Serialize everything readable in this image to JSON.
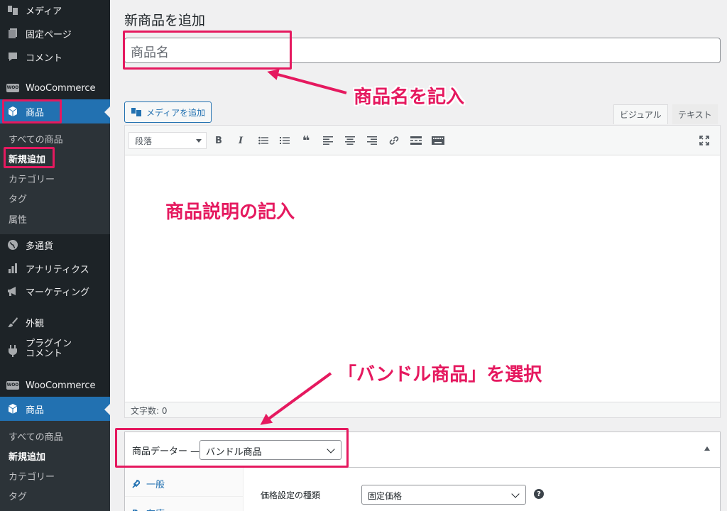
{
  "sidebar": {
    "items_top": [
      {
        "label": "メディア",
        "icon": "media-icon"
      },
      {
        "label": "固定ページ",
        "icon": "page-icon"
      },
      {
        "label": "コメント",
        "icon": "comment-icon"
      },
      {
        "label": "WooCommerce",
        "icon": "woo-icon"
      },
      {
        "label": "商品",
        "icon": "product-icon"
      }
    ],
    "sub_top": [
      "すべての商品",
      "新規追加",
      "カテゴリー",
      "タグ",
      "属性"
    ],
    "items_mid": [
      {
        "label": "多通貨",
        "icon": "globe-icon"
      },
      {
        "label": "アナリティクス",
        "icon": "chart-icon"
      },
      {
        "label": "マーケティング",
        "icon": "megaphone-icon"
      },
      {
        "label": "外観",
        "icon": "brush-icon"
      },
      {
        "label_line1": "プラグイン",
        "label_line2": "コメント",
        "icon": "plugin-icon"
      },
      {
        "label": "WooCommerce",
        "icon": "woo-icon"
      },
      {
        "label": "商品",
        "icon": "product-icon"
      }
    ],
    "sub_bottom": [
      "すべての商品",
      "新規追加",
      "カテゴリー",
      "タグ"
    ],
    "woo_badge": "WOO"
  },
  "main": {
    "page_title": "新商品を追加",
    "title_placeholder": "商品名",
    "media_button": "メディアを追加",
    "tabs": {
      "visual": "ビジュアル",
      "text": "テキスト"
    },
    "format_select": "段落",
    "toolbar": {
      "bold": "B",
      "italic": "I",
      "quote": "❝"
    },
    "word_count": "文字数: 0",
    "product_data_label": "商品データー —",
    "product_type": "バンドル商品",
    "pd_tabs": [
      "一般",
      "在庫"
    ],
    "price_label": "価格設定の種類",
    "price_value": "固定価格",
    "help": "?"
  },
  "annotations": {
    "title_note": "商品名を記入",
    "desc_note": "商品説明の記入",
    "bundle_note": "「バンドル商品」を選択"
  },
  "colors": {
    "accent": "#e5195f",
    "admin_blue": "#2271b1",
    "sidebar": "#1d2327"
  }
}
